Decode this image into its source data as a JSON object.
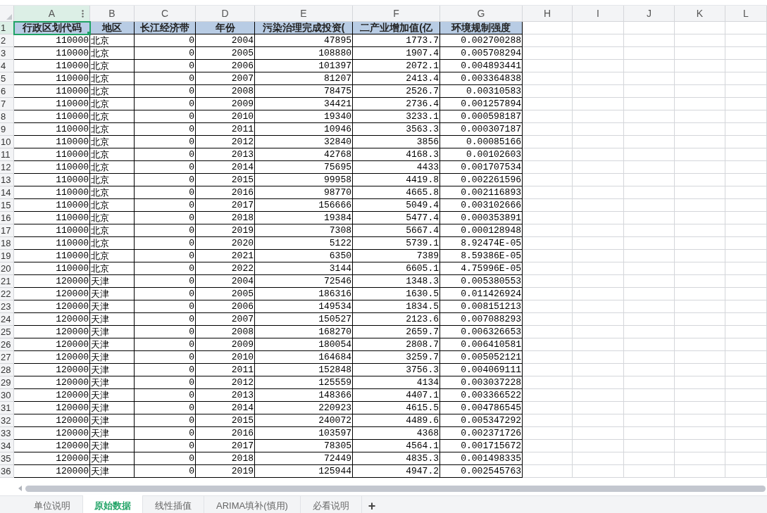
{
  "columns": [
    {
      "letter": "A",
      "selected": true
    },
    {
      "letter": "B",
      "selected": false
    },
    {
      "letter": "C",
      "selected": false
    },
    {
      "letter": "D",
      "selected": false
    },
    {
      "letter": "E",
      "selected": false
    },
    {
      "letter": "F",
      "selected": false
    },
    {
      "letter": "G",
      "selected": false
    },
    {
      "letter": "H",
      "selected": false
    },
    {
      "letter": "I",
      "selected": false
    },
    {
      "letter": "J",
      "selected": false
    },
    {
      "letter": "K",
      "selected": false
    },
    {
      "letter": "L",
      "selected": false
    }
  ],
  "rows": [
    {
      "row_number": "1",
      "selected": true,
      "kind": "header",
      "cells": [
        "行政区划代码",
        "地区",
        "长江经济带",
        "年份",
        "污染治理完成投资(",
        "二产业增加值(亿",
        "环境规制强度"
      ]
    },
    {
      "row_number": "2",
      "selected": false,
      "kind": "data",
      "cells": [
        "110000",
        "北京",
        "0",
        "2004",
        "47895",
        "1773.7",
        "0.002700288"
      ]
    },
    {
      "row_number": "3",
      "selected": false,
      "kind": "data",
      "cells": [
        "110000",
        "北京",
        "0",
        "2005",
        "108880",
        "1907.4",
        "0.005708294"
      ]
    },
    {
      "row_number": "4",
      "selected": false,
      "kind": "data",
      "cells": [
        "110000",
        "北京",
        "0",
        "2006",
        "101397",
        "2072.1",
        "0.004893441"
      ]
    },
    {
      "row_number": "5",
      "selected": false,
      "kind": "data",
      "cells": [
        "110000",
        "北京",
        "0",
        "2007",
        "81207",
        "2413.4",
        "0.003364838"
      ]
    },
    {
      "row_number": "6",
      "selected": false,
      "kind": "data",
      "cells": [
        "110000",
        "北京",
        "0",
        "2008",
        "78475",
        "2526.7",
        "0.00310583"
      ]
    },
    {
      "row_number": "7",
      "selected": false,
      "kind": "data",
      "cells": [
        "110000",
        "北京",
        "0",
        "2009",
        "34421",
        "2736.4",
        "0.001257894"
      ]
    },
    {
      "row_number": "8",
      "selected": false,
      "kind": "data",
      "cells": [
        "110000",
        "北京",
        "0",
        "2010",
        "19340",
        "3233.1",
        "0.000598187"
      ]
    },
    {
      "row_number": "9",
      "selected": false,
      "kind": "data",
      "cells": [
        "110000",
        "北京",
        "0",
        "2011",
        "10946",
        "3563.3",
        "0.000307187"
      ]
    },
    {
      "row_number": "10",
      "selected": false,
      "kind": "data",
      "cells": [
        "110000",
        "北京",
        "0",
        "2012",
        "32840",
        "3856",
        "0.00085166"
      ]
    },
    {
      "row_number": "11",
      "selected": false,
      "kind": "data",
      "cells": [
        "110000",
        "北京",
        "0",
        "2013",
        "42768",
        "4168.3",
        "0.00102603"
      ]
    },
    {
      "row_number": "12",
      "selected": false,
      "kind": "data",
      "cells": [
        "110000",
        "北京",
        "0",
        "2014",
        "75695",
        "4433",
        "0.001707534"
      ]
    },
    {
      "row_number": "13",
      "selected": false,
      "kind": "data",
      "cells": [
        "110000",
        "北京",
        "0",
        "2015",
        "99958",
        "4419.8",
        "0.002261596"
      ]
    },
    {
      "row_number": "14",
      "selected": false,
      "kind": "data",
      "cells": [
        "110000",
        "北京",
        "0",
        "2016",
        "98770",
        "4665.8",
        "0.002116893"
      ]
    },
    {
      "row_number": "15",
      "selected": false,
      "kind": "data",
      "cells": [
        "110000",
        "北京",
        "0",
        "2017",
        "156666",
        "5049.4",
        "0.003102666"
      ]
    },
    {
      "row_number": "16",
      "selected": false,
      "kind": "data",
      "cells": [
        "110000",
        "北京",
        "0",
        "2018",
        "19384",
        "5477.4",
        "0.000353891"
      ]
    },
    {
      "row_number": "17",
      "selected": false,
      "kind": "data",
      "cells": [
        "110000",
        "北京",
        "0",
        "2019",
        "7308",
        "5667.4",
        "0.000128948"
      ]
    },
    {
      "row_number": "18",
      "selected": false,
      "kind": "data",
      "cells": [
        "110000",
        "北京",
        "0",
        "2020",
        "5122",
        "5739.1",
        "8.92474E-05"
      ]
    },
    {
      "row_number": "19",
      "selected": false,
      "kind": "data",
      "cells": [
        "110000",
        "北京",
        "0",
        "2021",
        "6350",
        "7389",
        "8.59386E-05"
      ]
    },
    {
      "row_number": "20",
      "selected": false,
      "kind": "data",
      "cells": [
        "110000",
        "北京",
        "0",
        "2022",
        "3144",
        "6605.1",
        "4.75996E-05"
      ]
    },
    {
      "row_number": "21",
      "selected": false,
      "kind": "data",
      "cells": [
        "120000",
        "天津",
        "0",
        "2004",
        "72546",
        "1348.3",
        "0.005380553"
      ]
    },
    {
      "row_number": "22",
      "selected": false,
      "kind": "data",
      "cells": [
        "120000",
        "天津",
        "0",
        "2005",
        "186316",
        "1630.5",
        "0.011426924"
      ]
    },
    {
      "row_number": "23",
      "selected": false,
      "kind": "data",
      "cells": [
        "120000",
        "天津",
        "0",
        "2006",
        "149534",
        "1834.5",
        "0.008151213"
      ]
    },
    {
      "row_number": "24",
      "selected": false,
      "kind": "data",
      "cells": [
        "120000",
        "天津",
        "0",
        "2007",
        "150527",
        "2123.6",
        "0.007088293"
      ]
    },
    {
      "row_number": "25",
      "selected": false,
      "kind": "data",
      "cells": [
        "120000",
        "天津",
        "0",
        "2008",
        "168270",
        "2659.7",
        "0.006326653"
      ]
    },
    {
      "row_number": "26",
      "selected": false,
      "kind": "data",
      "cells": [
        "120000",
        "天津",
        "0",
        "2009",
        "180054",
        "2808.7",
        "0.006410581"
      ]
    },
    {
      "row_number": "27",
      "selected": false,
      "kind": "data",
      "cells": [
        "120000",
        "天津",
        "0",
        "2010",
        "164684",
        "3259.7",
        "0.005052121"
      ]
    },
    {
      "row_number": "28",
      "selected": false,
      "kind": "data",
      "cells": [
        "120000",
        "天津",
        "0",
        "2011",
        "152848",
        "3756.3",
        "0.004069111"
      ]
    },
    {
      "row_number": "29",
      "selected": false,
      "kind": "data",
      "cells": [
        "120000",
        "天津",
        "0",
        "2012",
        "125559",
        "4134",
        "0.003037228"
      ]
    },
    {
      "row_number": "30",
      "selected": false,
      "kind": "data",
      "cells": [
        "120000",
        "天津",
        "0",
        "2013",
        "148366",
        "4407.1",
        "0.003366522"
      ]
    },
    {
      "row_number": "31",
      "selected": false,
      "kind": "data",
      "cells": [
        "120000",
        "天津",
        "0",
        "2014",
        "220923",
        "4615.5",
        "0.004786545"
      ]
    },
    {
      "row_number": "32",
      "selected": false,
      "kind": "data",
      "cells": [
        "120000",
        "天津",
        "0",
        "2015",
        "240072",
        "4489.6",
        "0.005347292"
      ]
    },
    {
      "row_number": "33",
      "selected": false,
      "kind": "data",
      "cells": [
        "120000",
        "天津",
        "0",
        "2016",
        "103597",
        "4368",
        "0.002371726"
      ]
    },
    {
      "row_number": "34",
      "selected": false,
      "kind": "data",
      "cells": [
        "120000",
        "天津",
        "0",
        "2017",
        "78305",
        "4564.1",
        "0.001715672"
      ]
    },
    {
      "row_number": "35",
      "selected": false,
      "kind": "data",
      "cells": [
        "120000",
        "天津",
        "0",
        "2018",
        "72449",
        "4835.3",
        "0.001498335"
      ]
    },
    {
      "row_number": "36",
      "selected": false,
      "kind": "data",
      "cells": [
        "120000",
        "天津",
        "0",
        "2019",
        "125944",
        "4947.2",
        "0.002545763"
      ]
    }
  ],
  "sheet_tabs": [
    {
      "label": "单位说明",
      "selected": false
    },
    {
      "label": "原始数据",
      "selected": true
    },
    {
      "label": "线性插值",
      "selected": false
    },
    {
      "label": "ARIMA填补(慎用)",
      "selected": false
    },
    {
      "label": "必看说明",
      "selected": false
    }
  ],
  "add_sheet": "+"
}
